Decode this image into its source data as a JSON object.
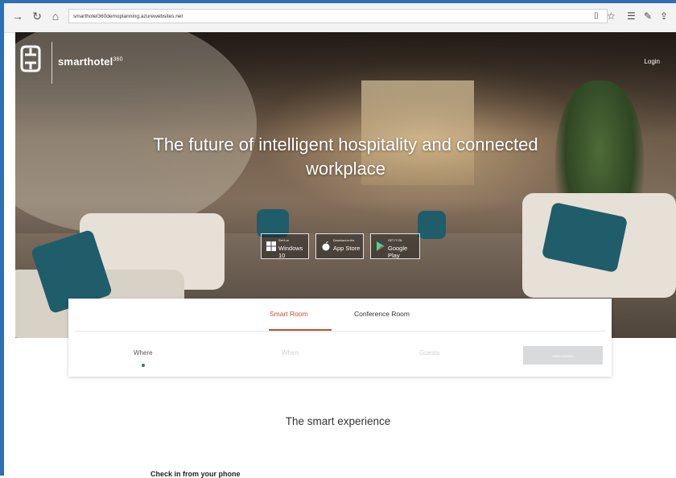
{
  "browser": {
    "url": "smarthotel360demoplanning.azurewebsites.net",
    "icons": [
      "forward-icon",
      "refresh-icon",
      "home-icon",
      "reading-view-icon",
      "favorite-star-icon",
      "favorites-hub-icon",
      "notes-icon",
      "share-icon"
    ]
  },
  "header": {
    "brand": "smarthotel",
    "brand_sup": "360",
    "login": "Login"
  },
  "hero": {
    "headline_line1": "The future of intelligent hospitality and connected",
    "headline_line2": "workplace"
  },
  "store_buttons": [
    {
      "small": "Get it on",
      "big": "Windows 10"
    },
    {
      "small": "Download on the",
      "big": "App Store"
    },
    {
      "small": "GET IT ON",
      "big": "Google Play"
    }
  ],
  "booking": {
    "tabs": [
      "Smart Room",
      "Conference Room"
    ],
    "active_tab": "Smart Room",
    "fields": {
      "where": "Where",
      "when": "When",
      "guests": "Guests"
    },
    "find_button": "FIND A ROOM"
  },
  "sections": {
    "smart_experience": "The smart experience",
    "checkin": "Check in from your phone"
  },
  "colors": {
    "accent": "#c5502c",
    "frame": "#2f6fb4",
    "button_disabled": "#d9dadb"
  }
}
